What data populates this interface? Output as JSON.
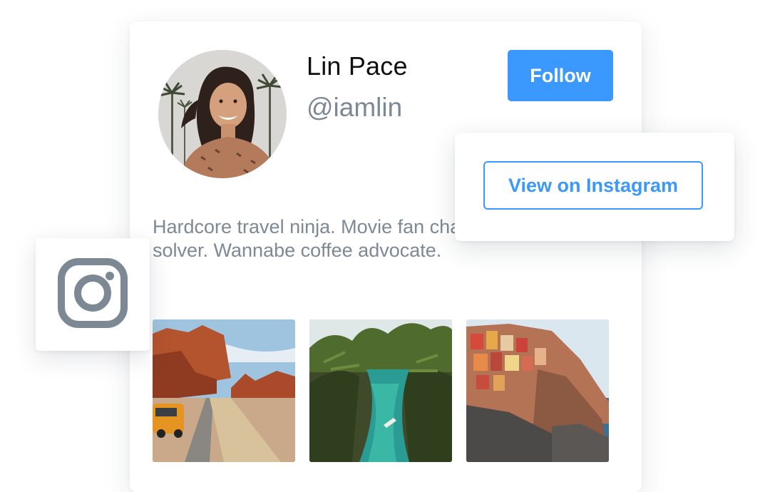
{
  "profile": {
    "name": "Lin Pace",
    "handle": "@iamlin",
    "bio": "Hardcore travel ninja. Movie fan charming problem solver. Wannabe coffee advocate."
  },
  "actions": {
    "follow_label": "Follow",
    "view_instagram_label": "View on Instagram"
  },
  "photos": [
    {
      "alt": "Desert road with orange van and red rock formations"
    },
    {
      "alt": "Turquoise river through palm jungle"
    },
    {
      "alt": "Colorful cliffside village by the sea"
    }
  ],
  "colors": {
    "accent": "#3a98ff",
    "muted_text": "#7d8994",
    "icon": "#7c8893"
  },
  "icons": {
    "badge": "instagram-icon"
  }
}
